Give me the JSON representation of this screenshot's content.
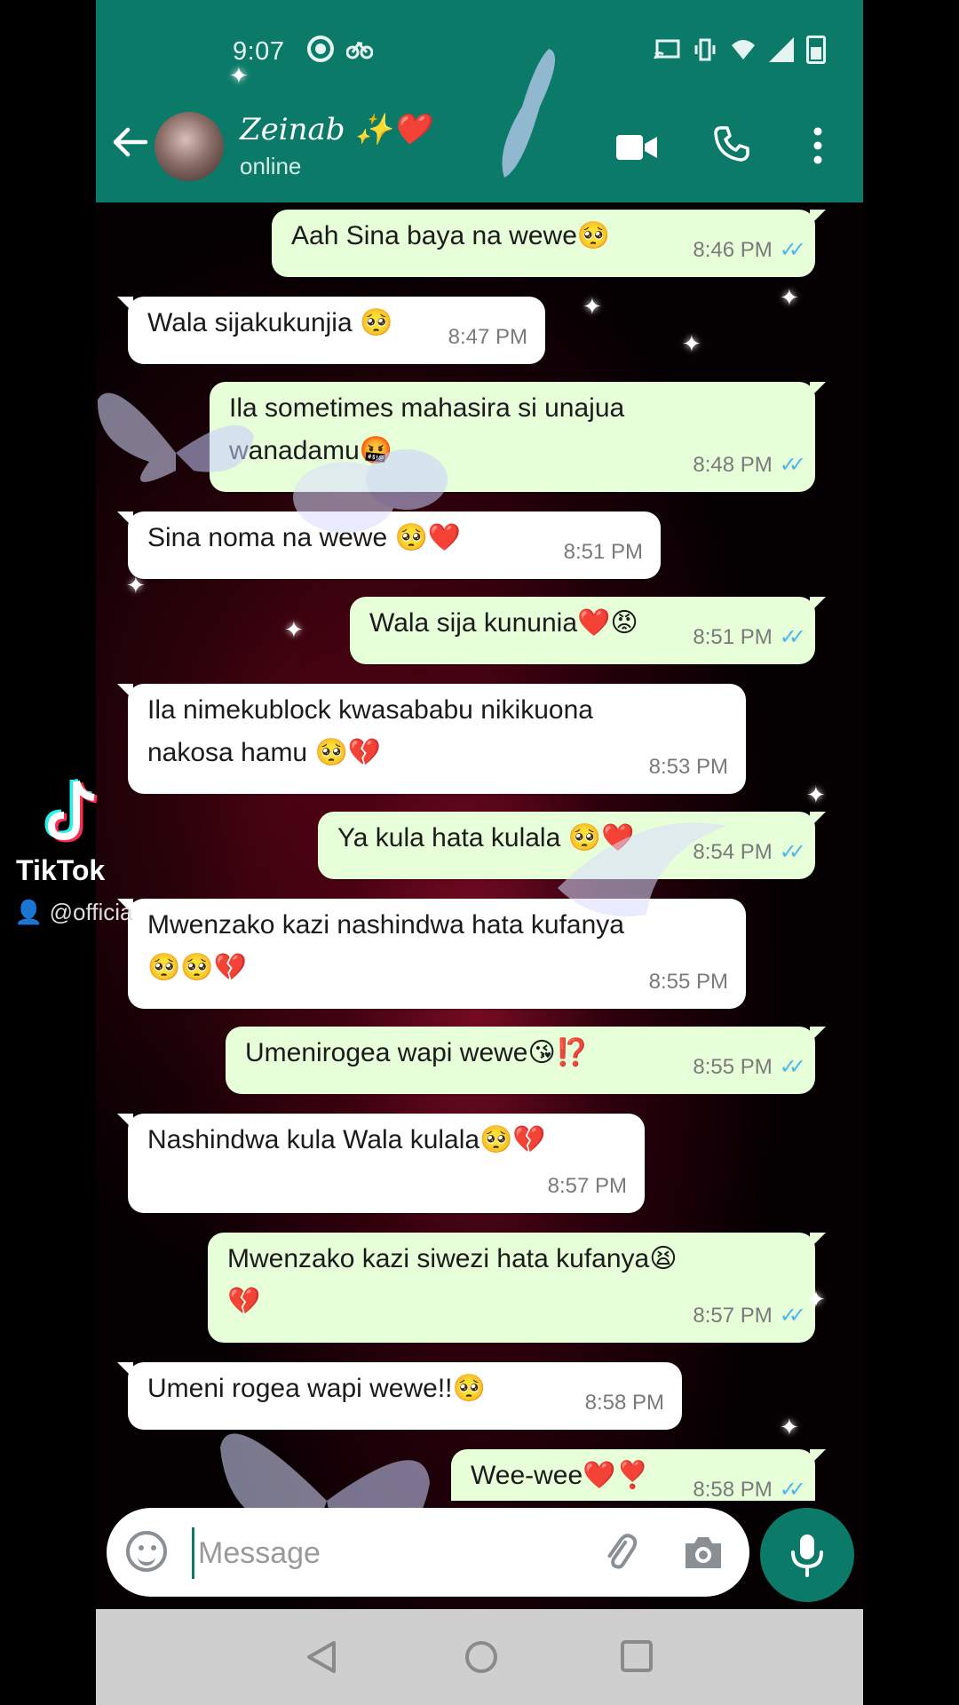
{
  "status_bar": {
    "time": "9:07"
  },
  "header": {
    "contact_name": "Zeinab ✨❤️",
    "contact_status": "online",
    "icons": [
      "back-arrow-icon",
      "video-call-icon",
      "phone-call-icon",
      "more-vert-icon"
    ]
  },
  "messages": [
    {
      "dir": "out",
      "text": "Aah Sina baya na wewe🥺",
      "time": "8:46 PM",
      "read": true
    },
    {
      "dir": "in",
      "text": "Wala sijakukunjia 🥺",
      "time": "8:47 PM"
    },
    {
      "dir": "out",
      "text": "Ila sometimes mahasira si unajua\nwanadamu🤬",
      "time": "8:48 PM",
      "read": true
    },
    {
      "dir": "in",
      "text": "Sina noma na wewe 🥺❤️",
      "time": "8:51 PM"
    },
    {
      "dir": "out",
      "text": "Wala sija kununia❤️😡",
      "time": "8:51 PM",
      "read": true
    },
    {
      "dir": "in",
      "text": "Ila nimekublock kwasababu nikikuona\nnakosa hamu 🥺💔",
      "time": "8:53 PM"
    },
    {
      "dir": "out",
      "text": "Ya kula hata kulala 🥺❤️",
      "time": "8:54 PM",
      "read": true
    },
    {
      "dir": "in",
      "text": "Mwenzako kazi nashindwa hata kufanya\n🥺🥺💔",
      "time": "8:55 PM"
    },
    {
      "dir": "out",
      "text": "Umenirogea wapi wewe😘⁉️",
      "time": "8:55 PM",
      "read": true
    },
    {
      "dir": "in",
      "text": "Nashindwa kula Wala kulala🥺💔",
      "time": "8:57 PM"
    },
    {
      "dir": "out",
      "text": "Mwenzako kazi siwezi hata kufanya😫\n💔",
      "time": "8:57 PM",
      "read": true
    },
    {
      "dir": "in",
      "text": "Umeni rogea wapi wewe!!🥺",
      "time": "8:58 PM"
    },
    {
      "dir": "out",
      "text": "Wee-wee❤️❣️",
      "time": "8:58 PM",
      "read": true
    }
  ],
  "input": {
    "placeholder": "Message"
  },
  "watermark": {
    "brand": "TikTok",
    "user": "@officia"
  },
  "colors": {
    "header": "#0c7a68",
    "outgoing_bubble": "#e7ffd9",
    "incoming_bubble": "#ffffff",
    "read_ticks": "#4fb6ec"
  }
}
